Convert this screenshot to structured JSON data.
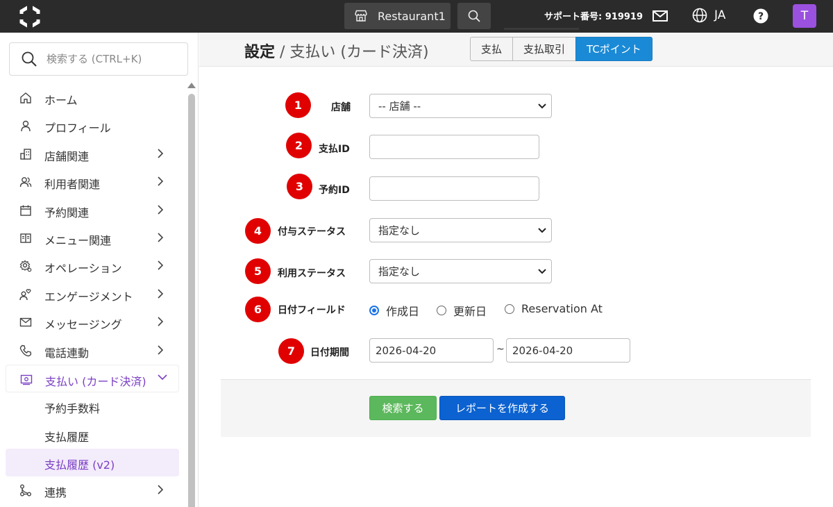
{
  "topbar": {
    "store_name": "Restaurant1",
    "support_text": "サポート番号: 919919",
    "lang": "JA",
    "avatar_initial": "T"
  },
  "sidebar": {
    "search_placeholder": "検索する (CTRL+K)",
    "items": [
      {
        "label": "ホーム",
        "icon": "home-icon"
      },
      {
        "label": "プロフィール",
        "icon": "user-icon"
      },
      {
        "label": "店舗関連",
        "icon": "building-icon"
      },
      {
        "label": "利用者関連",
        "icon": "users-icon"
      },
      {
        "label": "予約関連",
        "icon": "calendar-icon"
      },
      {
        "label": "メニュー関連",
        "icon": "book-icon"
      },
      {
        "label": "オペレーション",
        "icon": "gear-icon"
      },
      {
        "label": "エンゲージメント",
        "icon": "engagement-icon"
      },
      {
        "label": "メッセージング",
        "icon": "mail-icon"
      },
      {
        "label": "電話連動",
        "icon": "phone-icon"
      },
      {
        "label": "支払い (カード決済)",
        "icon": "payment-icon"
      },
      {
        "label": "予約手数料"
      },
      {
        "label": "支払履歴"
      },
      {
        "label": "支払履歴 (v2)"
      },
      {
        "label": "連携",
        "icon": "integration-icon"
      }
    ]
  },
  "header": {
    "title_bold": "設定",
    "title_rest": " / 支払い (カード決済)",
    "tabs": [
      "支払",
      "支払取引",
      "TCポイント"
    ]
  },
  "form": {
    "numbers": [
      "1",
      "2",
      "3",
      "4",
      "5",
      "6",
      "7"
    ],
    "store_label": "店舗",
    "store_value": "-- 店舗 --",
    "payment_id_label": "支払ID",
    "payment_id_value": "",
    "reservation_id_label": "予約ID",
    "reservation_id_value": "",
    "grant_status_label": "付与ステータス",
    "grant_status_value": "指定なし",
    "use_status_label": "利用ステータス",
    "use_status_value": "指定なし",
    "date_field_label": "日付フィールド",
    "date_field_options": [
      "作成日",
      "更新日",
      "Reservation At"
    ],
    "date_field_selected": "作成日",
    "date_range_label": "日付期間",
    "date_from": "2026-04-20",
    "date_sep": "~",
    "date_to": "2026-04-20"
  },
  "actions": {
    "search_label": "検索する",
    "report_label": "レポートを作成する"
  },
  "colors": {
    "accent": "#7b3fc4",
    "tab_active": "#1a8ad6",
    "number_badge": "#e00000",
    "search_button": "#5cb85c",
    "report_button": "#0b62d0"
  }
}
